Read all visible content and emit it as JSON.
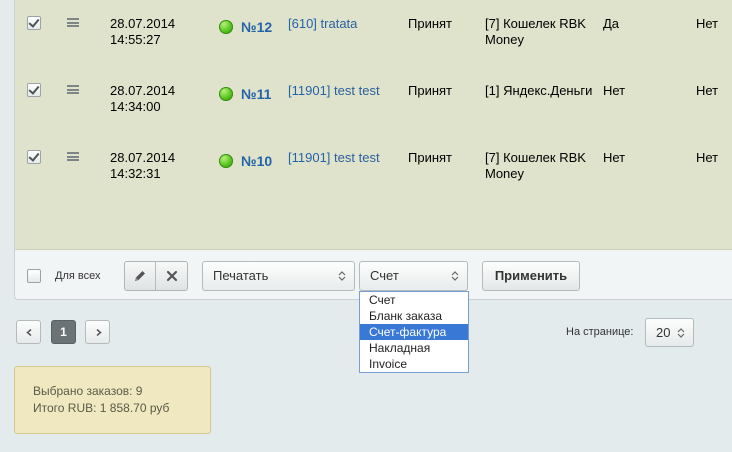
{
  "orders": [
    {
      "date": "28.07.2014\n14:55:27",
      "number": "№12",
      "buyer_id": "[610]",
      "buyer_name": "tratata",
      "status": "Принят",
      "payment": "[7] Кошелек RBK Money",
      "paid": "Да",
      "other": "Нет",
      "checked": true
    },
    {
      "date": "28.07.2014\n14:34:00",
      "number": "№11",
      "buyer_id": "[11901]",
      "buyer_name": "test test",
      "status": "Принят",
      "payment": "[1] Яндекс.Деньги",
      "paid": "Нет",
      "other": "Нет",
      "checked": true
    },
    {
      "date": "28.07.2014\n14:32:31",
      "number": "№10",
      "buyer_id": "[11901]",
      "buyer_name": "test test",
      "status": "Принят",
      "payment": "[7] Кошелек RBK Money",
      "paid": "Нет",
      "other": "Нет",
      "checked": true
    }
  ],
  "footer": {
    "for_all_label": "Для всех",
    "print_select": "Печатать",
    "doc_select": "Счет",
    "apply_label": "Применить"
  },
  "dropdown": {
    "options": [
      "Счет",
      "Бланк заказа",
      "Счет-фактура",
      "Накладная",
      "Invoice"
    ],
    "highlighted_index": 2
  },
  "pagination": {
    "current_page": "1",
    "per_page_label": "На странице:",
    "per_page_value": "20"
  },
  "summary": {
    "selected": "Выбрано заказов: 9",
    "total": "Итого RUB: 1 858.70 руб"
  },
  "colors": {
    "row_bg": "#dfe3cb",
    "link": "#2463a8",
    "highlight": "#3a78d6",
    "summary_bg": "#efe8c0"
  },
  "icons": [
    "checkbox-icon",
    "drag-handle-icon",
    "status-dot-icon",
    "pencil-icon",
    "close-icon",
    "select-arrows-icon",
    "chevron-left-icon",
    "chevron-right-icon"
  ]
}
